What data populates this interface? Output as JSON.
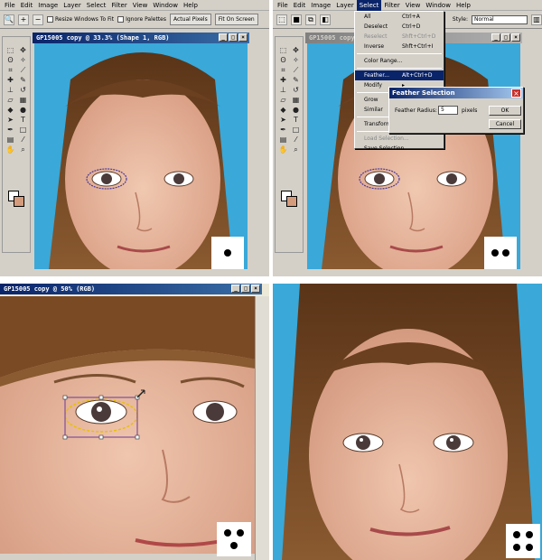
{
  "panel1": {
    "menu": [
      "File",
      "Edit",
      "Image",
      "Layer",
      "Select",
      "Filter",
      "View",
      "Window",
      "Help"
    ],
    "options": {
      "resize_label": "Resize Windows To Fit",
      "ignore_label": "Ignore Palettes",
      "actual_pixels": "Actual Pixels",
      "fit_on_screen": "Fit On Screen"
    },
    "doc_title": "GP15005 copy @ 33.3% (Shape 1, RGB)"
  },
  "panel2": {
    "menu": [
      "File",
      "Edit",
      "Image",
      "Layer",
      "Select",
      "Filter",
      "View",
      "Window",
      "Help"
    ],
    "style_label": "Style:",
    "style_value": "Normal",
    "doc_title": "GP15005 copy @ 33.3% (Shape 1, RGB)",
    "select_menu": [
      {
        "label": "All",
        "shortcut": "Ctrl+A",
        "state": "normal"
      },
      {
        "label": "Deselect",
        "shortcut": "Ctrl+D",
        "state": "normal"
      },
      {
        "label": "Reselect",
        "shortcut": "Shft+Ctrl+D",
        "state": "disabled"
      },
      {
        "label": "Inverse",
        "shortcut": "Shft+Ctrl+I",
        "state": "normal"
      },
      {
        "sep": true
      },
      {
        "label": "Color Range...",
        "shortcut": "",
        "state": "normal"
      },
      {
        "sep": true
      },
      {
        "label": "Feather...",
        "shortcut": "Alt+Ctrl+D",
        "state": "highlight"
      },
      {
        "label": "Modify",
        "shortcut": "▸",
        "state": "normal"
      },
      {
        "sep": true
      },
      {
        "label": "Grow",
        "shortcut": "",
        "state": "normal"
      },
      {
        "label": "Similar",
        "shortcut": "",
        "state": "normal"
      },
      {
        "sep": true
      },
      {
        "label": "Transform Selection",
        "shortcut": "",
        "state": "normal"
      },
      {
        "sep": true
      },
      {
        "label": "Load Selection...",
        "shortcut": "",
        "state": "disabled"
      },
      {
        "label": "Save Selection...",
        "shortcut": "",
        "state": "normal"
      }
    ],
    "feather_dialog": {
      "title": "Feather Selection",
      "radius_label": "Feather Radius:",
      "radius_value": "5",
      "unit": "pixels",
      "ok": "OK",
      "cancel": "Cancel"
    }
  },
  "panel3": {
    "doc_title": "GP15005 copy @ 50% (RGB)"
  },
  "colors": {
    "background_blue": "#3aa8d8",
    "skin": "#e8b8a0",
    "hair": "#7a4a24",
    "titlebar": "#0a246a",
    "selection": "#4a3a9a"
  }
}
